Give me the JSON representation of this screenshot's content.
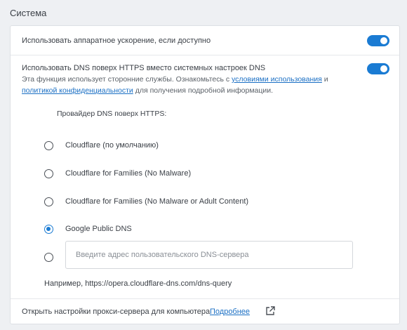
{
  "section": {
    "title": "Система"
  },
  "hardware": {
    "label": "Использовать аппаратное ускорение, если доступно",
    "enabled": true
  },
  "dns": {
    "label": "Использовать DNS поверх HTTPS вместо системных настроек DNS",
    "enabled": true,
    "desc_line1_prefix": "Эта функция использует сторонние службы. Ознакомьтесь с",
    "terms_link": "условиями использования",
    "desc_line1_suffix": "и",
    "privacy_link": "политикой конфиденциальности",
    "desc_line2_suffix": "для получения подробной информации.",
    "provider_heading": "Провайдер DNS поверх HTTPS:",
    "options": [
      {
        "label": "Cloudflare (по умолчанию)",
        "checked": false
      },
      {
        "label": "Cloudflare for Families (No Malware)",
        "checked": false
      },
      {
        "label": "Cloudflare for Families (No Malware or Adult Content)",
        "checked": false
      },
      {
        "label": "Google Public DNS",
        "checked": true
      }
    ],
    "custom_placeholder": "Введите адрес пользовательского DNS-сервера",
    "example": "Например, https://opera.cloudflare-dns.com/dns-query"
  },
  "proxy": {
    "label": "Открыть настройки прокси-сервера для компьютера",
    "link": "Подробнее",
    "icon": "external-link-icon"
  },
  "colors": {
    "accent": "#1a7bd3",
    "link": "#1a6fc4"
  }
}
